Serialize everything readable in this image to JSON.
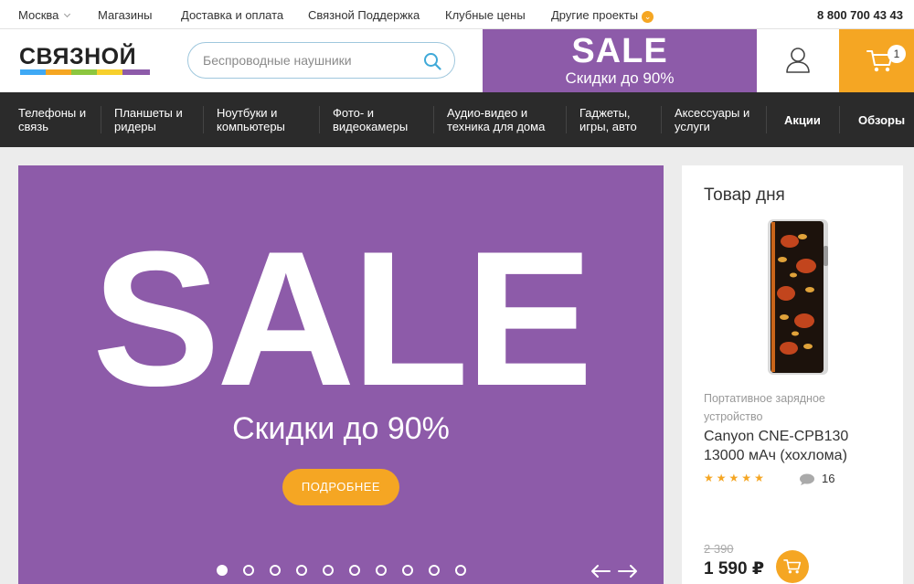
{
  "topbar": {
    "city": "Москва",
    "links": [
      "Магазины",
      "Доставка и оплата",
      "Связной Поддержка",
      "Клубные цены",
      "Другие проекты"
    ],
    "phone": "8 800 700 43 43"
  },
  "header": {
    "logo_text": "СВЯЗНОЙ",
    "search_placeholder": "Беспроводные наушники",
    "sale_title": "SALE",
    "sale_subtitle": "Скидки до 90%",
    "cart_count": "1"
  },
  "nav": {
    "items": [
      {
        "line1": "Телефоны и",
        "line2": "связь"
      },
      {
        "line1": "Планшеты и",
        "line2": "ридеры"
      },
      {
        "line1": "Ноутбуки и",
        "line2": "компьютеры"
      },
      {
        "line1": "Фото- и",
        "line2": "видеокамеры"
      },
      {
        "line1": "Аудио-видео и",
        "line2": "техника для дома"
      },
      {
        "line1": "Гаджеты,",
        "line2": "игры, авто"
      },
      {
        "line1": "Аксессуары и",
        "line2": "услуги"
      }
    ],
    "promo": "Акции",
    "reviews": "Обзоры"
  },
  "hero": {
    "title": "SALE",
    "subtitle": "Скидки до 90%",
    "button_label": "ПОДРОБНЕЕ",
    "slides_total": 10,
    "active_slide": 1
  },
  "deal": {
    "title": "Товар дня",
    "category": "Портативное зарядное устройство",
    "name": "Canyon CNE-CPB130 13000 мАч (хохлома)",
    "rating": 5,
    "comments": "16",
    "old_price": "2 390",
    "price": "1 590 ₽"
  },
  "colors": {
    "accent": "#8d5ba9",
    "cta": "#f5a623",
    "nav_bg": "#2b2b2b"
  },
  "icons": [
    "chevron-down-icon",
    "search-icon",
    "user-icon",
    "cart-icon",
    "comment-icon",
    "arrow-left-icon",
    "arrow-right-icon",
    "star-icon"
  ]
}
